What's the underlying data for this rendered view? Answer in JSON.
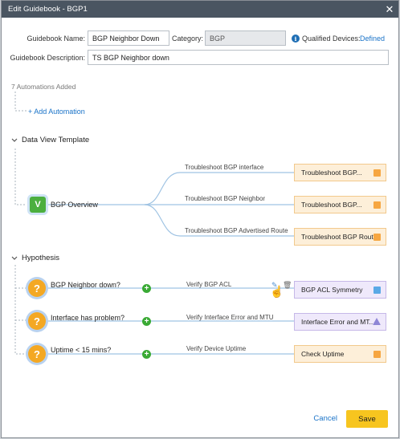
{
  "dialog": {
    "title": "Edit Guidebook - BGP1",
    "close_symbol": "✕"
  },
  "form": {
    "name_label": "Guidebook Name:",
    "name_value": "BGP Neighbor Down",
    "category_label": "Category:",
    "category_value": "BGP",
    "qualified_label": "Qualified Devices:",
    "qualified_link": "Defined",
    "description_label": "Guidebook Description:",
    "description_value": "TS BGP Neighbor down"
  },
  "automations": {
    "count_text": "7 Automations Added",
    "add_link": "+ Add Automation"
  },
  "data_view": {
    "header": "Data View Template",
    "node_letter": "V",
    "node_label": "BGP Overview",
    "branches": [
      {
        "label": "Troubleshoot BGP interface",
        "card": "Troubleshoot BGP...",
        "icon": "orange-book-icon"
      },
      {
        "label": "Troubleshoot BGP Neighbor",
        "card": "Troubleshoot BGP...",
        "icon": "orange-book-icon"
      },
      {
        "label": "Troubleshoot BGP Advertised Route",
        "card": "Troubleshoot BGP Rout...",
        "icon": "orange-book-icon"
      }
    ]
  },
  "hypothesis": {
    "header": "Hypothesis",
    "items": [
      {
        "symbol": "?",
        "label": "BGP Neighbor down?",
        "branch": "Verify BGP ACL",
        "card": "BGP ACL Symmetry",
        "card_style": "purple",
        "icon": "blue-info-icon"
      },
      {
        "symbol": "?",
        "label": "Interface has problem?",
        "branch": "Verify Interface Error and MTU",
        "card": "Interface Error and MT...",
        "card_style": "purple",
        "icon": "purple-triangle-icon"
      },
      {
        "symbol": "?",
        "label": "Uptime < 15 mins?",
        "branch": "Verify Device Uptime",
        "card": "Check Uptime",
        "card_style": "orange",
        "icon": "orange-book-icon"
      }
    ]
  },
  "footer": {
    "cancel_label": "Cancel",
    "save_label": "Save"
  },
  "colors": {
    "titlebar": "#4a5561",
    "save": "#f7c51f",
    "link": "#1a73c8",
    "card_orange": "#fdefd9",
    "card_purple": "#efe9fb"
  }
}
